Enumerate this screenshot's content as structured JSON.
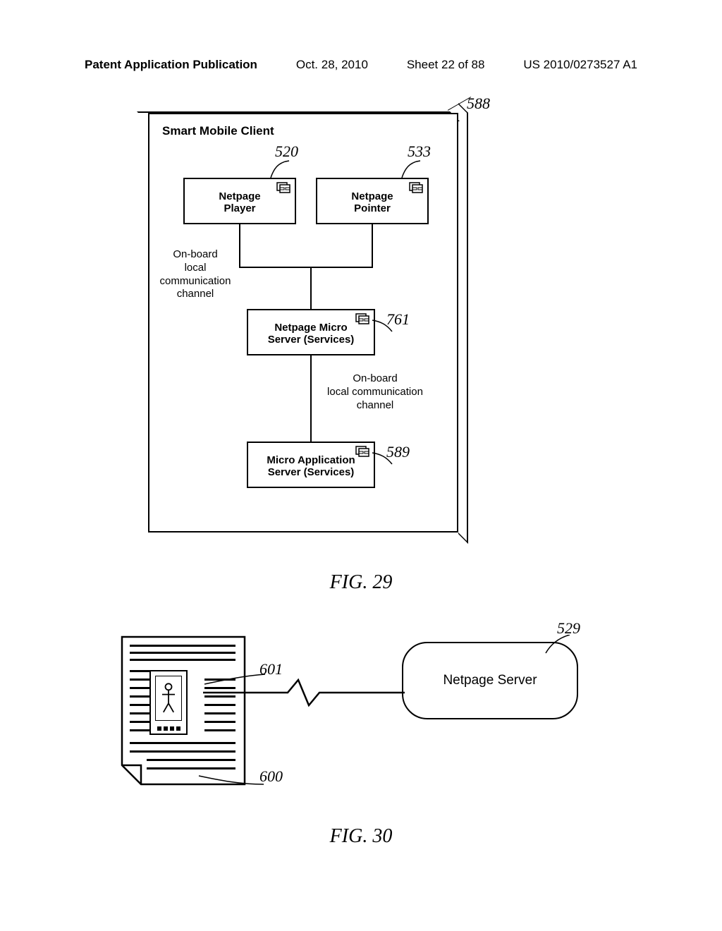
{
  "header": {
    "publication": "Patent Application Publication",
    "date": "Oct. 28, 2010",
    "sheet": "Sheet 22 of 88",
    "pubno": "US 2010/0273527 A1"
  },
  "fig29": {
    "panel_title": "Smart Mobile Client",
    "boxes": {
      "player": "Netpage\nPlayer",
      "pointer": "Netpage\nPointer",
      "micro": "Netpage Micro\nServer (Services)",
      "app": "Micro Application\nServer (Services)"
    },
    "annotations": {
      "channel1": "On-board\nlocal\ncommunication\nchannel",
      "channel2": "On-board\nlocal communication\nchannel"
    },
    "refs": {
      "r588": "588",
      "r520": "520",
      "r533": "533",
      "r761": "761",
      "r589": "589"
    },
    "caption": "FIG. 29"
  },
  "fig30": {
    "refs": {
      "r601": "601",
      "r600": "600",
      "r529": "529"
    },
    "server": "Netpage Server",
    "caption": "FIG. 30"
  }
}
